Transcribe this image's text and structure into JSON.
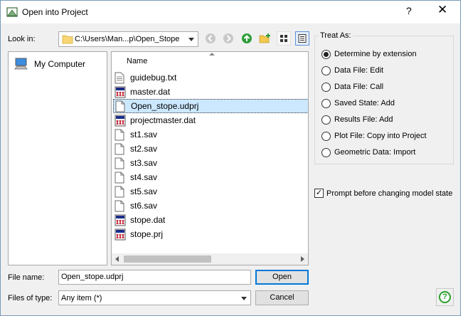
{
  "window": {
    "title": "Open into Project",
    "help_glyph": "?",
    "close_glyph": "✕"
  },
  "look_in": {
    "label": "Look in:",
    "path": "C:\\Users\\Man...p\\Open_Stope"
  },
  "toolbar": {
    "icons": [
      "back-icon",
      "forward-icon",
      "up-folder-icon",
      "new-folder-icon",
      "list-view-icon",
      "detail-view-icon"
    ]
  },
  "sidebar": {
    "items": [
      {
        "label": "My Computer",
        "icon": "computer-icon"
      }
    ]
  },
  "file_list": {
    "column_name": "Name",
    "files": [
      {
        "name": "guidebug.txt",
        "icon": "text-file-icon"
      },
      {
        "name": "master.dat",
        "icon": "dat-file-icon"
      },
      {
        "name": "Open_stope.udprj",
        "icon": "blank-file-icon",
        "selected": true
      },
      {
        "name": "projectmaster.dat",
        "icon": "dat-file-icon"
      },
      {
        "name": "st1.sav",
        "icon": "blank-file-icon"
      },
      {
        "name": "st2.sav",
        "icon": "blank-file-icon"
      },
      {
        "name": "st3.sav",
        "icon": "blank-file-icon"
      },
      {
        "name": "st4.sav",
        "icon": "blank-file-icon"
      },
      {
        "name": "st5.sav",
        "icon": "blank-file-icon"
      },
      {
        "name": "st6.sav",
        "icon": "blank-file-icon"
      },
      {
        "name": "stope.dat",
        "icon": "dat-file-icon"
      },
      {
        "name": "stope.prj",
        "icon": "dat-file-icon"
      }
    ]
  },
  "treat_as": {
    "title": "Treat As:",
    "options": [
      {
        "label": "Determine by extension",
        "checked": true
      },
      {
        "label": "Data File: Edit",
        "checked": false
      },
      {
        "label": "Data File: Call",
        "checked": false
      },
      {
        "label": "Saved State: Add",
        "checked": false
      },
      {
        "label": "Results File: Add",
        "checked": false
      },
      {
        "label": "Plot File: Copy into Project",
        "checked": false
      },
      {
        "label": "Geometric Data: Import",
        "checked": false
      }
    ]
  },
  "prompt": {
    "label": "Prompt before changing model state",
    "checked": true,
    "check_glyph": "✓"
  },
  "file_name": {
    "label": "File name:",
    "value": "Open_stope.udprj"
  },
  "files_of_type": {
    "label": "Files of type:",
    "value": "Any item (*)"
  },
  "buttons": {
    "open": "Open",
    "cancel": "Cancel",
    "help": "?"
  },
  "colors": {
    "selection": "#cce8ff",
    "accent": "#0078d7",
    "help_green": "#2aa02a"
  }
}
